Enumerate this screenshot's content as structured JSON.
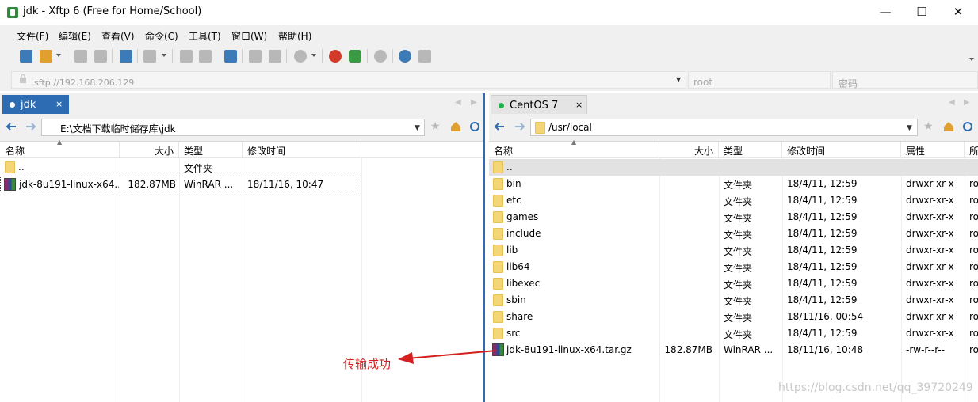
{
  "window": {
    "title": "jdk - Xftp 6 (Free for Home/School)",
    "minimize": "—",
    "maximize": "☐",
    "close": "✕"
  },
  "menu": [
    "文件(F)",
    "编辑(E)",
    "查看(V)",
    "命令(C)",
    "工具(T)",
    "窗口(W)",
    "帮助(H)"
  ],
  "address": {
    "host": "sftp://192.168.206.129",
    "user_placeholder": "root",
    "password_placeholder": "密码"
  },
  "left_pane": {
    "tab_label": "jdk",
    "tab_close": "×",
    "path": "E:\\文档下载临时储存库\\jdk",
    "columns": [
      "名称",
      "大小",
      "类型",
      "修改时间"
    ],
    "rows": [
      {
        "name": "..",
        "size": "",
        "type": "文件夹",
        "modified": "",
        "icon": "folder"
      },
      {
        "name": "jdk-8u191-linux-x64....",
        "size": "182.87MB",
        "type": "WinRAR ...",
        "modified": "18/11/16, 10:47",
        "icon": "rar"
      }
    ]
  },
  "right_pane": {
    "tab_label": "CentOS 7",
    "tab_close": "×",
    "path": "/usr/local",
    "columns": [
      "名称",
      "大小",
      "类型",
      "修改时间",
      "属性",
      "所"
    ],
    "rows": [
      {
        "name": "..",
        "size": "",
        "type": "",
        "modified": "",
        "attr": "",
        "owner": "",
        "icon": "folder"
      },
      {
        "name": "bin",
        "size": "",
        "type": "文件夹",
        "modified": "18/4/11, 12:59",
        "attr": "drwxr-xr-x",
        "owner": "ro",
        "icon": "folder"
      },
      {
        "name": "etc",
        "size": "",
        "type": "文件夹",
        "modified": "18/4/11, 12:59",
        "attr": "drwxr-xr-x",
        "owner": "ro",
        "icon": "folder"
      },
      {
        "name": "games",
        "size": "",
        "type": "文件夹",
        "modified": "18/4/11, 12:59",
        "attr": "drwxr-xr-x",
        "owner": "ro",
        "icon": "folder"
      },
      {
        "name": "include",
        "size": "",
        "type": "文件夹",
        "modified": "18/4/11, 12:59",
        "attr": "drwxr-xr-x",
        "owner": "ro",
        "icon": "folder"
      },
      {
        "name": "lib",
        "size": "",
        "type": "文件夹",
        "modified": "18/4/11, 12:59",
        "attr": "drwxr-xr-x",
        "owner": "ro",
        "icon": "folder"
      },
      {
        "name": "lib64",
        "size": "",
        "type": "文件夹",
        "modified": "18/4/11, 12:59",
        "attr": "drwxr-xr-x",
        "owner": "ro",
        "icon": "folder"
      },
      {
        "name": "libexec",
        "size": "",
        "type": "文件夹",
        "modified": "18/4/11, 12:59",
        "attr": "drwxr-xr-x",
        "owner": "ro",
        "icon": "folder"
      },
      {
        "name": "sbin",
        "size": "",
        "type": "文件夹",
        "modified": "18/4/11, 12:59",
        "attr": "drwxr-xr-x",
        "owner": "ro",
        "icon": "folder"
      },
      {
        "name": "share",
        "size": "",
        "type": "文件夹",
        "modified": "18/11/16, 00:54",
        "attr": "drwxr-xr-x",
        "owner": "ro",
        "icon": "folder"
      },
      {
        "name": "src",
        "size": "",
        "type": "文件夹",
        "modified": "18/4/11, 12:59",
        "attr": "drwxr-xr-x",
        "owner": "ro",
        "icon": "folder"
      },
      {
        "name": "jdk-8u191-linux-x64.tar.gz",
        "size": "182.87MB",
        "type": "WinRAR ...",
        "modified": "18/11/16, 10:48",
        "attr": "-rw-r--r--",
        "owner": "ro",
        "icon": "rar"
      }
    ]
  },
  "annotation": {
    "text": "传输成功",
    "color": "#d42020"
  },
  "watermark": "https://blog.csdn.net/qq_39720249",
  "colors": {
    "active_tab": "#2d6bb3",
    "connected_dot": "#1fb24a"
  }
}
